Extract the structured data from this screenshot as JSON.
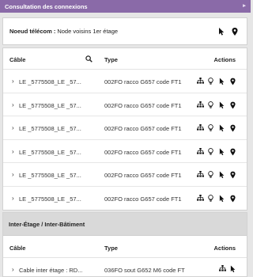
{
  "window": {
    "title": "Consultation des connexions",
    "collapse_icon": "chevron-right-icon"
  },
  "node": {
    "label": "Noeud télécom :",
    "value": "Node voisins 1er étage"
  },
  "cables_table": {
    "headers": {
      "cable": "Câble",
      "type": "Type",
      "actions": "Actions"
    },
    "rows": [
      {
        "name": "LE _5775508_LE _57...",
        "type": "002FO racco G657 code FT1"
      },
      {
        "name": "LE _5775508_LE _57...",
        "type": "002FO racco G657 code FT1"
      },
      {
        "name": "LE _5775508_LE _57...",
        "type": "002FO racco G657 code FT1"
      },
      {
        "name": "LE _5775508_LE _57...",
        "type": "002FO racco G657 code FT1"
      },
      {
        "name": "LE _5775508_LE _57...",
        "type": "002FO racco G657 code FT1"
      },
      {
        "name": "LE _5775508_LE _57...",
        "type": "002FO racco G657 code FT1"
      }
    ]
  },
  "inter_section": {
    "title": "Inter-Étage / Inter-Bâtiment",
    "headers": {
      "cable": "Câble",
      "type": "Type",
      "actions": "Actions"
    },
    "rows": [
      {
        "name": "Cable inter étage : RD...",
        "type": "036FO sout G652 M6 code FT"
      }
    ]
  },
  "colors": {
    "titlebar": "#8a6aa8",
    "section_header": "#d9d9d9"
  }
}
